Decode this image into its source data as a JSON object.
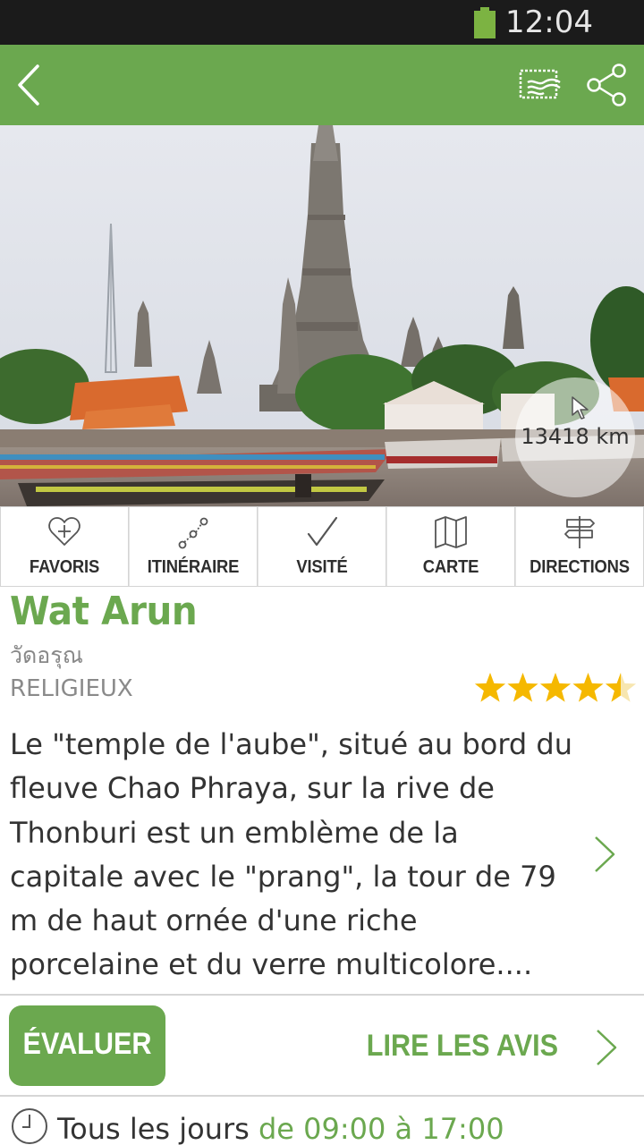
{
  "status_bar": {
    "time": "12:04 PM",
    "battery_color": "#7cb342"
  },
  "app_bar": {
    "background": "#6ba84f",
    "icons": [
      "back-icon",
      "postcard-icon",
      "share-icon"
    ]
  },
  "hero": {
    "image_name": "wat-arun-photo",
    "distance": "13418 km"
  },
  "actions": [
    {
      "label": "FAVORIS",
      "icon": "heart-plus-icon"
    },
    {
      "label": "ITINÉRAIRE",
      "icon": "route-icon"
    },
    {
      "label": "VISITÉ",
      "icon": "checkmark-icon"
    },
    {
      "label": "CARTE",
      "icon": "map-icon"
    },
    {
      "label": "DIRECTIONS",
      "icon": "signpost-icon"
    }
  ],
  "place": {
    "name": "Wat Arun",
    "native_name": "วัดอรุณ",
    "category": "RELIGIEUX",
    "rating": 4.5,
    "rating_max": 5,
    "description": "Le \"temple de l'aube\", situé au bord du fleuve Chao Phraya, sur la rive de Thonburi est un emblème de la capitale avec le \"prang\", la tour de 79 m de haut ornée d'une riche porcelaine et du verre multicolore...."
  },
  "reviews": {
    "evaluate_label": "ÉVALUER",
    "read_label": "LIRE LES AVIS"
  },
  "hours": {
    "days": "Tous les jours",
    "range": "de 09:00 à 17:00"
  },
  "colors": {
    "accent": "#6ba84f",
    "star": "#f5b800"
  }
}
